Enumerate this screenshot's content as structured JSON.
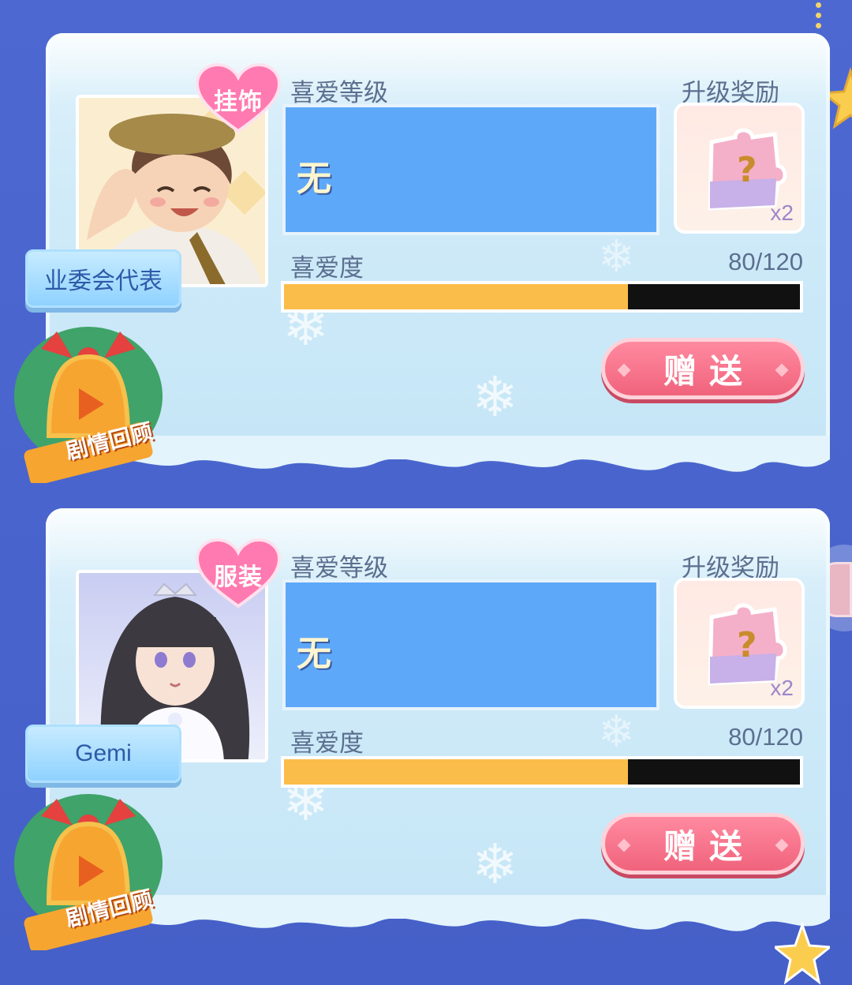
{
  "cards": [
    {
      "tag": "挂饰",
      "name": "业委会代表",
      "level_label": "喜爱等级",
      "level_value": "无",
      "reward_label": "升级奖励",
      "reward_count": "x2",
      "affection_label": "喜爱度",
      "affection_value": "80/120",
      "affection_progress": 0.667,
      "gift_button": "赠送",
      "story_review": "剧情回顾"
    },
    {
      "tag": "服装",
      "name": "Gemi",
      "level_label": "喜爱等级",
      "level_value": "无",
      "reward_label": "升级奖励",
      "reward_count": "x2",
      "affection_label": "喜爱度",
      "affection_value": "80/120",
      "affection_progress": 0.667,
      "gift_button": "赠送",
      "story_review": "剧情回顾"
    }
  ],
  "colors": {
    "background": "#4a66cc",
    "card": "#cfeaf8",
    "level_box": "#5ea8fa",
    "progress_fill": "#fbbd49",
    "gift_button": "#f0637c"
  }
}
